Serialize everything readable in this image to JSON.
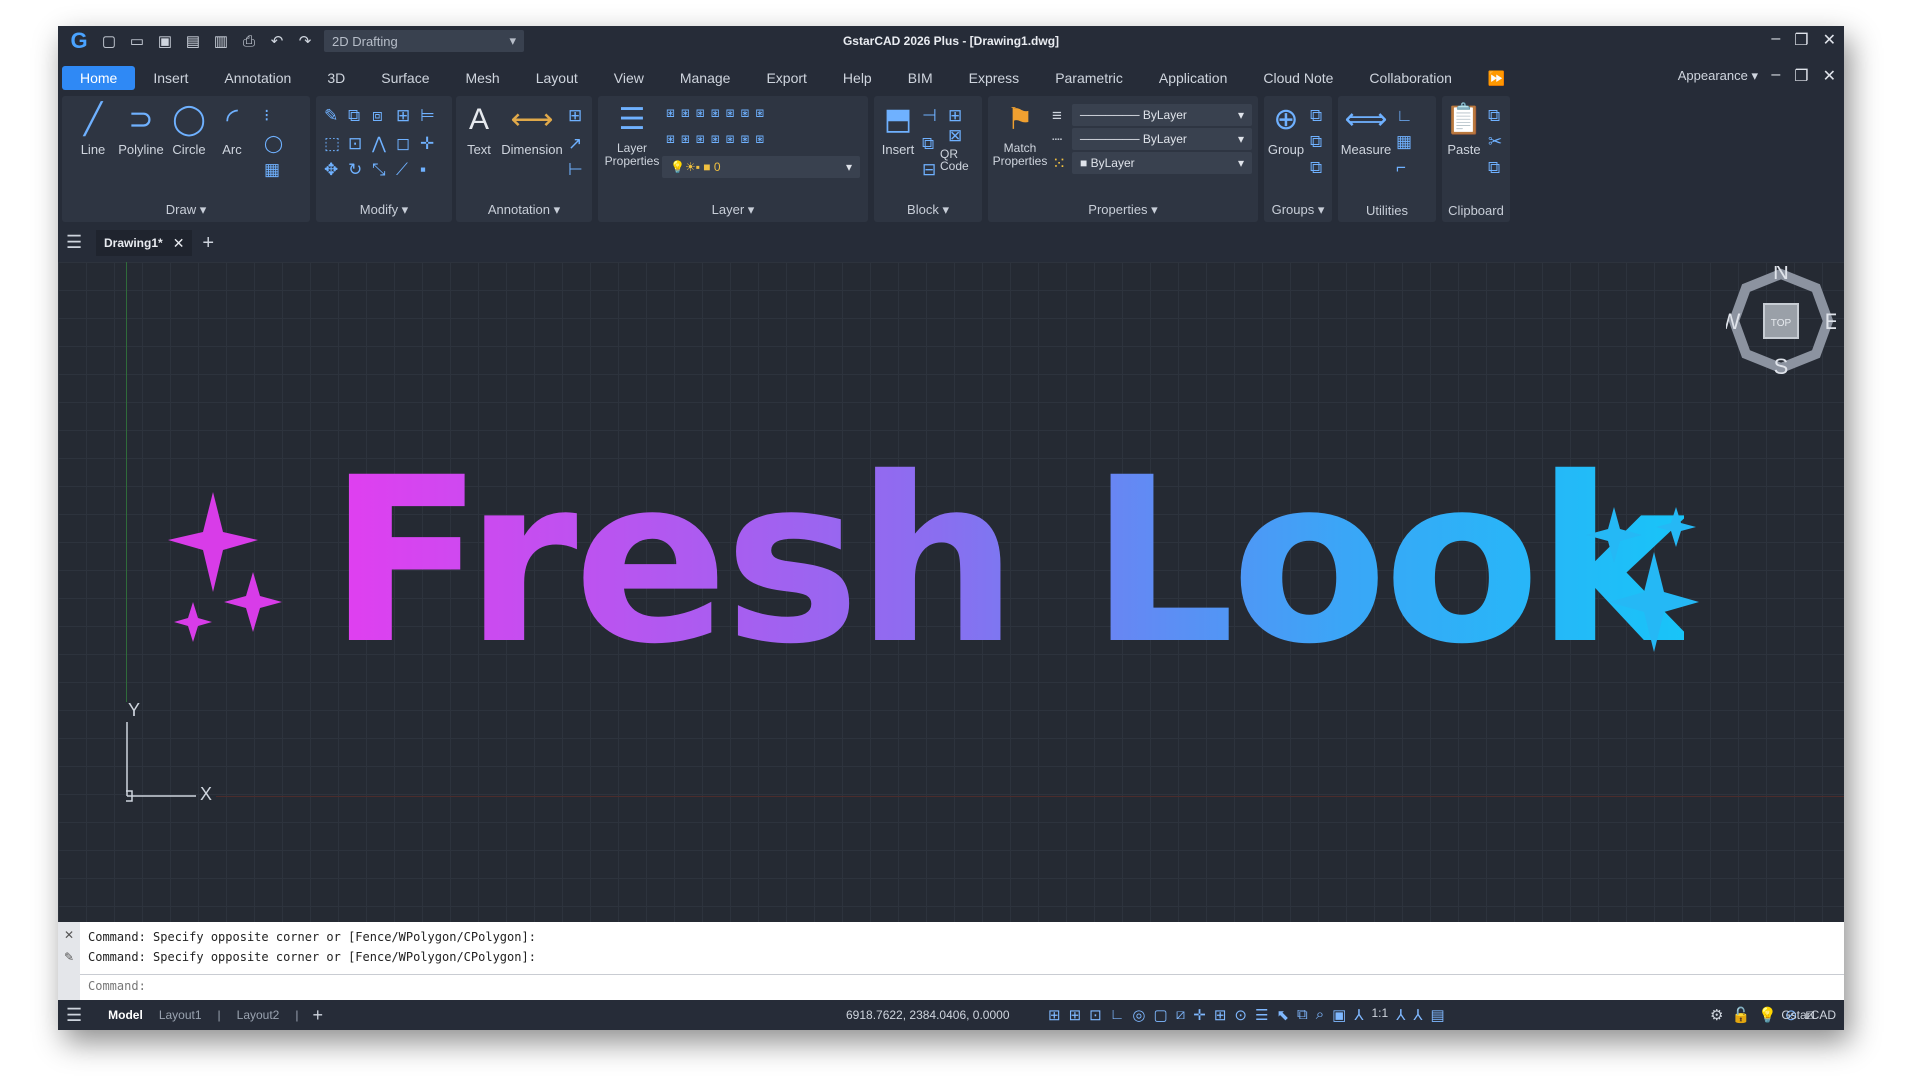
{
  "window": {
    "title": "GstarCAD 2026 Plus - [Drawing1.dwg]",
    "workspace": "2D Drafting"
  },
  "menu": {
    "tabs": [
      "Home",
      "Insert",
      "Annotation",
      "3D",
      "Surface",
      "Mesh",
      "Layout",
      "View",
      "Manage",
      "Export",
      "Help",
      "BIM",
      "Express",
      "Parametric",
      "Application",
      "Cloud Note",
      "Collaboration"
    ],
    "appearance": "Appearance"
  },
  "ribbon": {
    "draw": {
      "label": "Draw",
      "tools": [
        "Line",
        "Polyline",
        "Circle",
        "Arc"
      ]
    },
    "modify": {
      "label": "Modify"
    },
    "annotation": {
      "label": "Annotation",
      "tools": [
        "Text",
        "Dimension"
      ]
    },
    "layer": {
      "label": "Layer",
      "tool": "Layer Properties",
      "current": "0"
    },
    "block": {
      "label": "Block",
      "tools": [
        "Insert",
        "QR Code"
      ]
    },
    "properties": {
      "label": "Properties",
      "tool": "Match Properties",
      "color": "ByLayer",
      "linetype": "ByLayer",
      "lineweight": "ByLayer"
    },
    "groups": {
      "label": "Groups",
      "tool": "Group"
    },
    "utilities": {
      "label": "Utilities",
      "tool": "Measure"
    },
    "clipboard": {
      "label": "Clipboard",
      "tool": "Paste"
    }
  },
  "doc_tab": {
    "name": "Drawing1*"
  },
  "canvas": {
    "headline": "Fresh Look",
    "compass": {
      "n": "N",
      "s": "S",
      "e": "E",
      "w": "W",
      "center": "TOP"
    },
    "ucs": {
      "x": "X",
      "y": "Y"
    }
  },
  "command": {
    "history": [
      "Command: Specify opposite corner or [Fence/WPolygon/CPolygon]:",
      "Command: Specify opposite corner or [Fence/WPolygon/CPolygon]:"
    ],
    "prompt": "Command:"
  },
  "status": {
    "layouts": [
      "Model",
      "Layout1",
      "Layout2"
    ],
    "coordinates": "6918.7622, 2384.0406, 0.0000",
    "scale": "1:1",
    "brand": "GstarCAD"
  }
}
